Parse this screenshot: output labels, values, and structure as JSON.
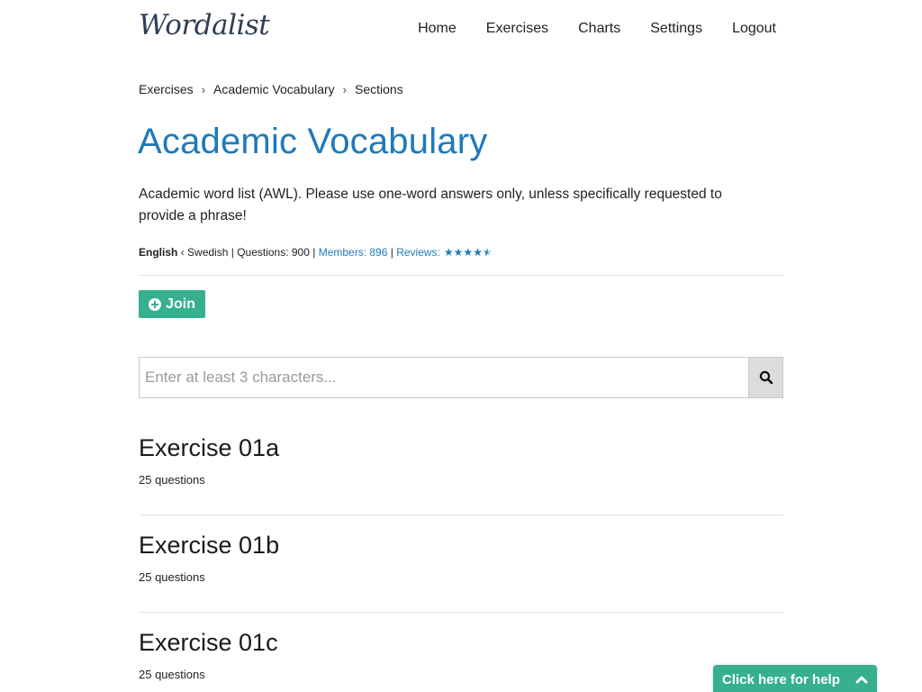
{
  "header": {
    "logo": "Wordalist",
    "nav": [
      "Home",
      "Exercises",
      "Charts",
      "Settings",
      "Logout"
    ]
  },
  "breadcrumb": [
    "Exercises",
    "Academic Vocabulary",
    "Sections"
  ],
  "page": {
    "title": "Academic Vocabulary",
    "description": "Academic word list (AWL). Please use one-word answers only, unless specifically requested to provide a phrase!"
  },
  "meta": {
    "from_language": "English",
    "direction_symbol": "‹",
    "to_language": "Swedish",
    "questions_label": "Questions: 900",
    "members_label": "Members: 896",
    "reviews_label": "Reviews:",
    "rating": 4.5,
    "rating_max": 5,
    "separator": " | "
  },
  "actions": {
    "join_label": "Join"
  },
  "search": {
    "placeholder": "Enter at least 3 characters...",
    "value": ""
  },
  "exercises": [
    {
      "title": "Exercise 01a",
      "count": "25 questions"
    },
    {
      "title": "Exercise 01b",
      "count": "25 questions"
    },
    {
      "title": "Exercise 01c",
      "count": "25 questions"
    }
  ],
  "help": {
    "label": "Click here for help"
  },
  "colors": {
    "accent_blue": "#1f7ab8",
    "accent_green": "#36b08e",
    "logo": "#2d3e55"
  }
}
